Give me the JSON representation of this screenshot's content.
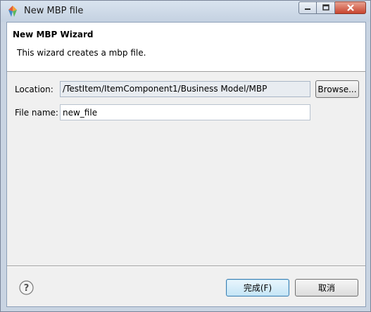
{
  "window": {
    "title": "New MBP file",
    "app_icon": "eclipse-diamond-icon",
    "controls": [
      "minimize-icon",
      "maximize-icon",
      "close-icon"
    ]
  },
  "wizard": {
    "title": "New MBP Wizard",
    "description": "This wizard creates a mbp file."
  },
  "form": {
    "location_label": "Location:",
    "location_value": "/TestItem/ItemComponent1/Business Model/MBP",
    "browse_label": "Browse...",
    "filename_label": "File name:",
    "filename_value": "new_file"
  },
  "footer": {
    "help_icon": "help-question-icon",
    "finish_label": "完成(F)",
    "cancel_label": "取消"
  },
  "colors": {
    "default_button_border": "#3c7fb1",
    "close_button": "#c8452f"
  }
}
